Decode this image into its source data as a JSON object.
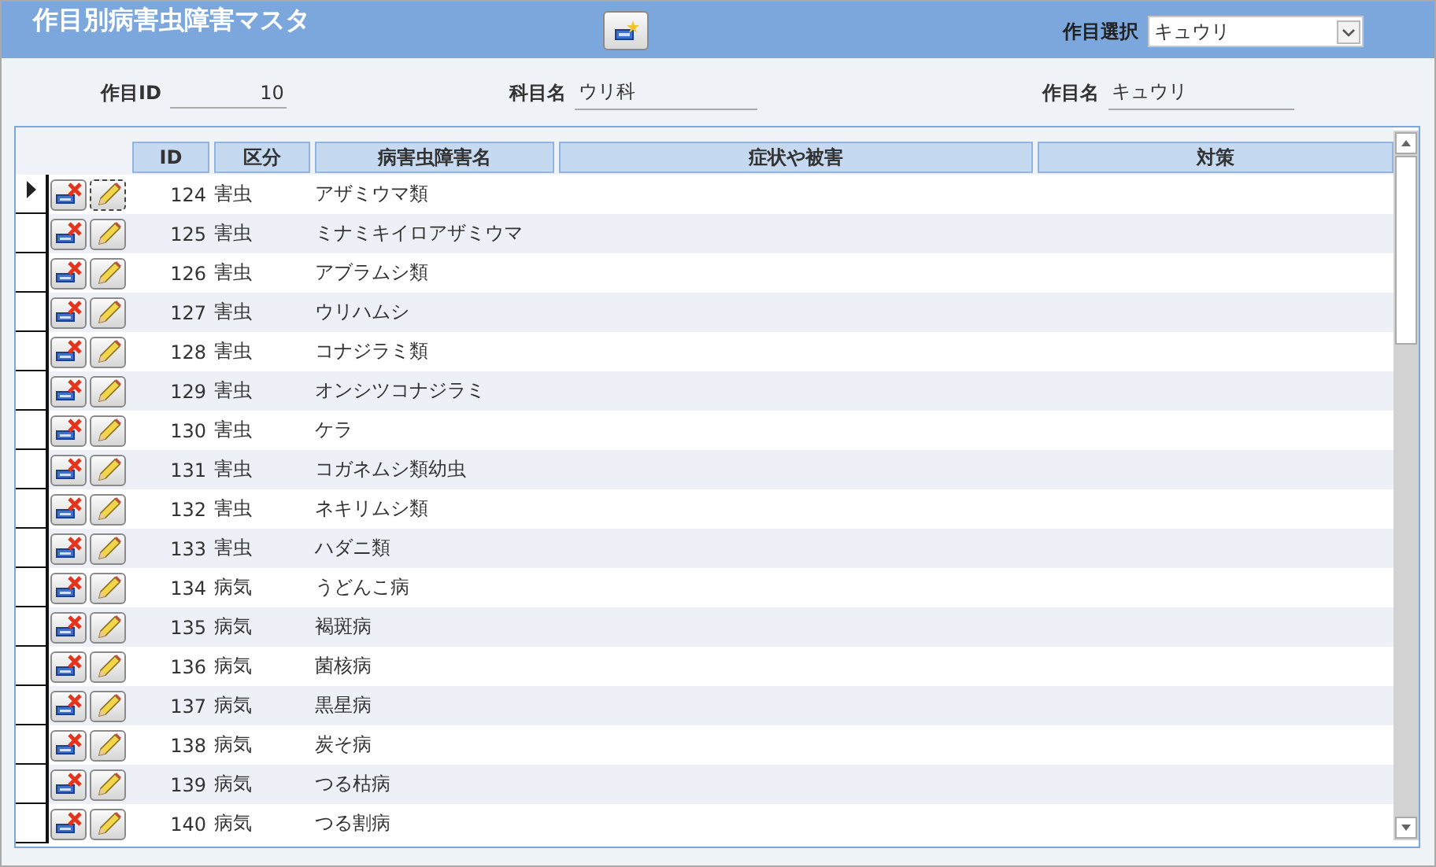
{
  "window": {
    "title": "作目別病害虫障害マスタ"
  },
  "crop_select": {
    "label": "作目選択",
    "value": "キュウリ"
  },
  "fields": [
    {
      "label": "作目ID",
      "value": "10"
    },
    {
      "label": "科目名",
      "value": "ウリ科"
    },
    {
      "label": "作目名",
      "value": "キュウリ"
    }
  ],
  "table": {
    "columns": [
      "ID",
      "区分",
      "病害虫障害名",
      "症状や被害",
      "対策"
    ],
    "rows": [
      {
        "id": "124",
        "category": "害虫",
        "name": "アザミウマ類",
        "selected": true
      },
      {
        "id": "125",
        "category": "害虫",
        "name": "ミナミキイロアザミウマ",
        "selected": false
      },
      {
        "id": "126",
        "category": "害虫",
        "name": "アブラムシ類",
        "selected": false
      },
      {
        "id": "127",
        "category": "害虫",
        "name": "ウリハムシ",
        "selected": false
      },
      {
        "id": "128",
        "category": "害虫",
        "name": "コナジラミ類",
        "selected": false
      },
      {
        "id": "129",
        "category": "害虫",
        "name": "オンシツコナジラミ",
        "selected": false
      },
      {
        "id": "130",
        "category": "害虫",
        "name": "ケラ",
        "selected": false
      },
      {
        "id": "131",
        "category": "害虫",
        "name": "コガネムシ類幼虫",
        "selected": false
      },
      {
        "id": "132",
        "category": "害虫",
        "name": "ネキリムシ類",
        "selected": false
      },
      {
        "id": "133",
        "category": "害虫",
        "name": "ハダニ類",
        "selected": false
      },
      {
        "id": "134",
        "category": "病気",
        "name": "うどんこ病",
        "selected": false
      },
      {
        "id": "135",
        "category": "病気",
        "name": "褐斑病",
        "selected": false
      },
      {
        "id": "136",
        "category": "病気",
        "name": "菌核病",
        "selected": false
      },
      {
        "id": "137",
        "category": "病気",
        "name": "黒星病",
        "selected": false
      },
      {
        "id": "138",
        "category": "病気",
        "name": "炭そ病",
        "selected": false
      },
      {
        "id": "139",
        "category": "病気",
        "name": "つる枯病",
        "selected": false
      },
      {
        "id": "140",
        "category": "病気",
        "name": "つる割病",
        "selected": false
      }
    ]
  }
}
